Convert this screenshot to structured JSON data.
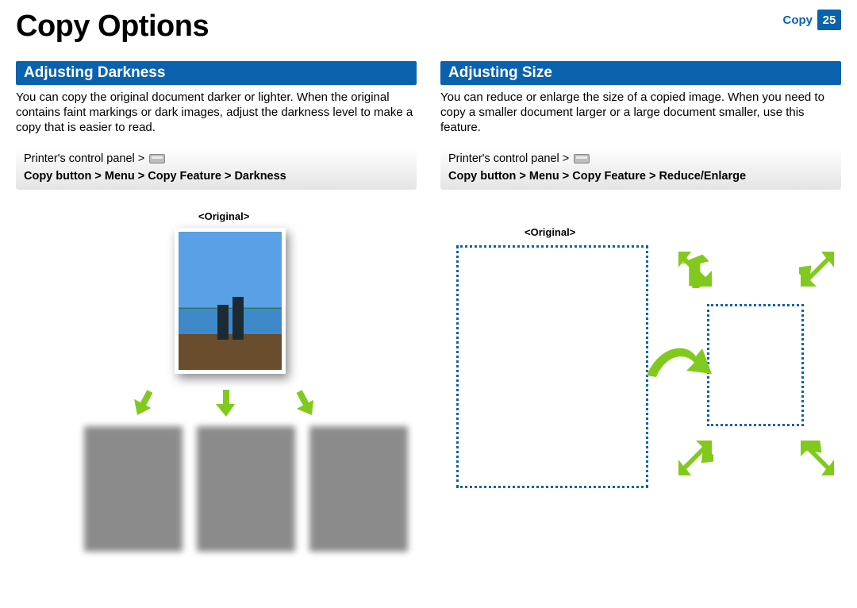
{
  "header": {
    "title": "Copy Options",
    "section": "Copy",
    "page_number": "25"
  },
  "left": {
    "heading": "Adjusting Darkness",
    "body": "You can copy the original document darker or lighter. When the original contains faint markings or dark images, adjust the darkness level to make a copy that is easier to read.",
    "path_prefix": "Printer's control panel >",
    "path_bold": "Copy button > Menu > Copy Feature > Darkness",
    "orig_label": "<Original>"
  },
  "right": {
    "heading": "Adjusting Size",
    "body": "You can reduce or enlarge the size of a copied image. When you need to copy a smaller document larger or a large document smaller, use this feature.",
    "path_prefix": "Printer's control panel >",
    "path_bold": "Copy button > Menu > Copy Feature > Reduce/Enlarge",
    "orig_label": "<Original>"
  }
}
